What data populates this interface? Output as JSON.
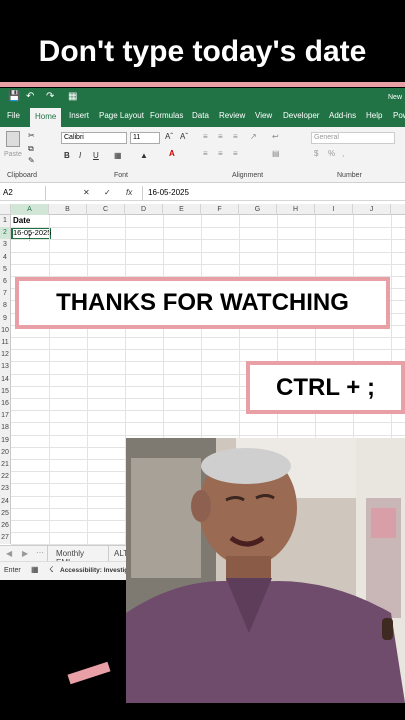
{
  "video": {
    "title": "Don't type today's date",
    "callout_thanks": "THANKS FOR WATCHING",
    "callout_shortcut": "CTRL + ;"
  },
  "excel": {
    "quick_access": {
      "save_icon": "save-icon",
      "undo_icon": "undo-icon",
      "redo_icon": "redo-icon",
      "title_stub": "New"
    },
    "tabs": [
      "File",
      "Home",
      "Insert",
      "Page Layout",
      "Formulas",
      "Data",
      "Review",
      "View",
      "Developer",
      "Add-ins",
      "Help",
      "Pow"
    ],
    "active_tab": "Home",
    "ribbon": {
      "clipboard_label": "Clipboard",
      "paste_label": "Paste",
      "font_name": "Calibri",
      "font_size": "11",
      "bold": "B",
      "italic": "I",
      "underline": "U",
      "font_label": "Font",
      "alignment_label": "Alignment",
      "number_format": "General",
      "number_label": "Number"
    },
    "formula_bar": {
      "name_box": "A2",
      "fx": "fx",
      "value": "16-05-2025"
    },
    "columns": [
      "A",
      "B",
      "C",
      "D",
      "E",
      "F",
      "G",
      "H",
      "I",
      "J"
    ],
    "rows": [
      "1",
      "2",
      "3",
      "4",
      "5",
      "6",
      "7",
      "8",
      "9",
      "10",
      "11",
      "12",
      "13",
      "14",
      "15",
      "16",
      "17",
      "18",
      "19",
      "20",
      "21",
      "22",
      "23",
      "24",
      "25",
      "26",
      "27"
    ],
    "cells": {
      "A1": "Date",
      "A2": "16-05-2025"
    },
    "sheet_tabs": [
      "Monthly EMI",
      "ALT"
    ],
    "status": {
      "mode": "Enter",
      "accessibility": "Accessibility: Investiga"
    }
  },
  "colors": {
    "excel_green": "#217346",
    "accent_pink": "#e8a0a6",
    "background": "#000000"
  }
}
